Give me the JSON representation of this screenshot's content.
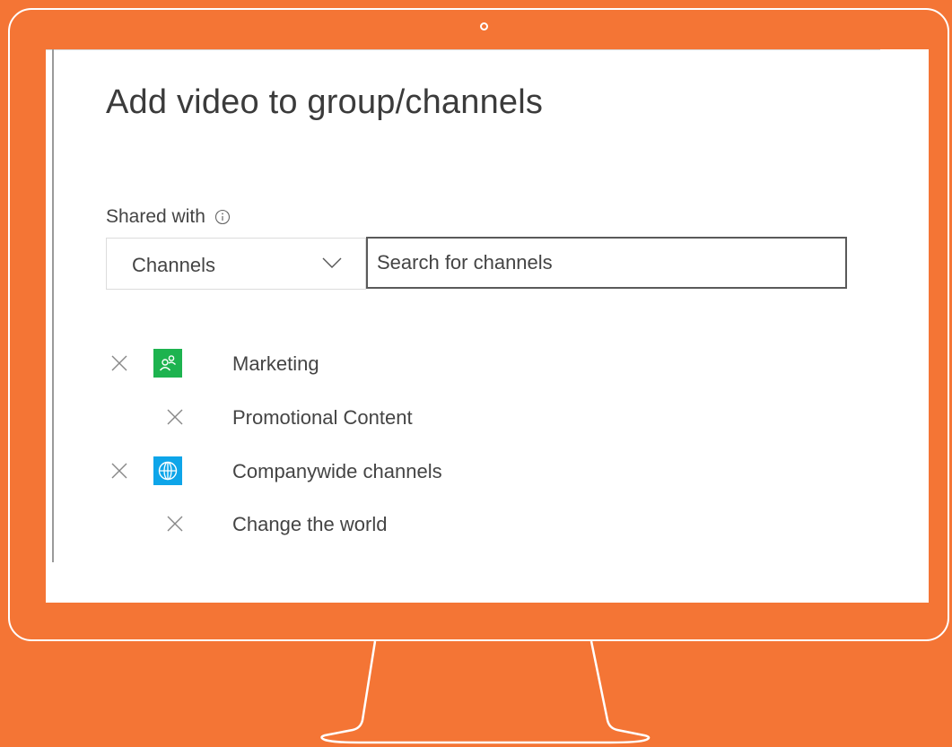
{
  "dialog": {
    "title": "Add video to group/channels",
    "shared_with_label": "Shared with",
    "scope_dropdown": {
      "selected": "Channels"
    },
    "search": {
      "placeholder": "Search for channels",
      "value": ""
    },
    "items": [
      {
        "label": "Marketing",
        "type": "group",
        "icon": "people-icon",
        "icon_color": "#1DB34F"
      },
      {
        "label": "Promotional Content",
        "type": "channel",
        "parent": "Marketing"
      },
      {
        "label": "Companywide channels",
        "type": "group",
        "icon": "globe-icon",
        "icon_color": "#0EA5E9"
      },
      {
        "label": "Change the world",
        "type": "channel",
        "parent": "Companywide channels"
      }
    ]
  },
  "colors": {
    "background": "#F47535",
    "screen": "#FFFFFF",
    "outline": "#FFFFFF"
  }
}
